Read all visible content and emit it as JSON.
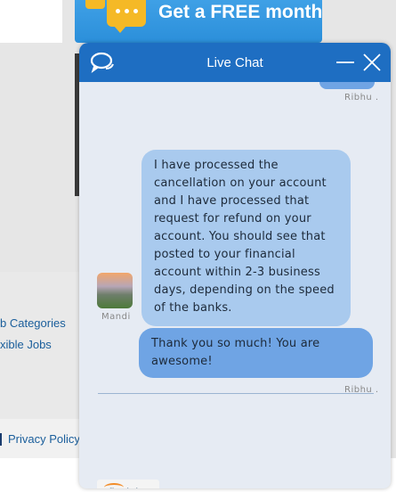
{
  "background": {
    "promo_text": "Get a FREE month",
    "links": [
      "b Categories",
      "xible Jobs"
    ],
    "footer_link": "Privacy Policy"
  },
  "chat": {
    "title": "Live Chat",
    "icons": {
      "logo": "chat-bubbles-icon",
      "minimize": "minimize-icon",
      "close": "close-icon"
    },
    "colors": {
      "header": "#1e6ec2",
      "agent_bubble": "#a9caee",
      "user_bubble": "#6fa4e4"
    },
    "messages": [
      {
        "sender": "Ribhu",
        "meta": "Ribhu .",
        "text": ""
      },
      {
        "sender": "Mandi",
        "meta": "Mandi",
        "text": "I have processed the cancellation on your account and I have processed that request for refund on your account. You should see that posted to your financial account within 2-3 business days, depending on the speed of the banks."
      },
      {
        "sender": "Ribhu",
        "meta": "Ribhu .",
        "text": "Thank you so much! You are awesome!"
      }
    ],
    "branding": "flexjobs"
  }
}
